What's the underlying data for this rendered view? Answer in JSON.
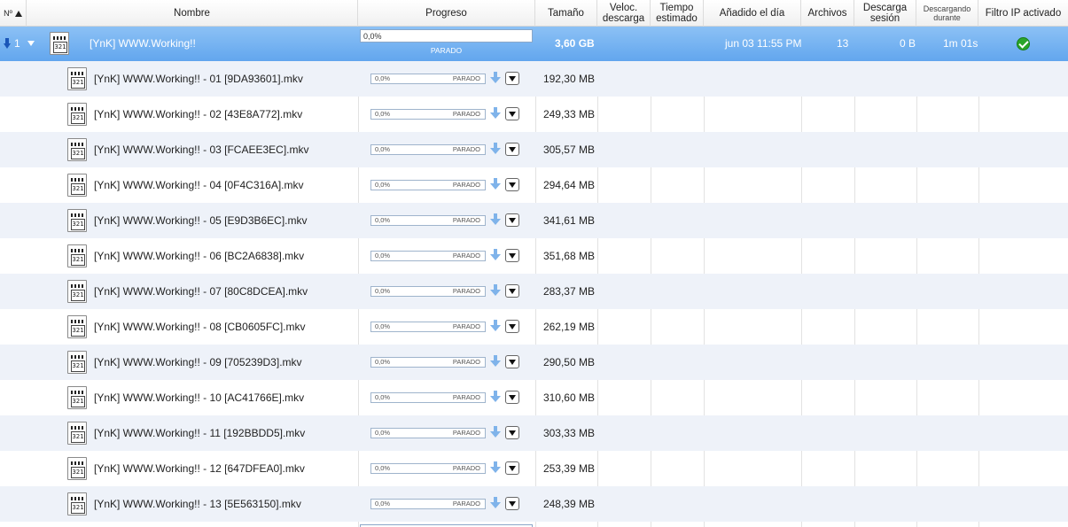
{
  "header": {
    "num": "Nº",
    "nombre": "Nombre",
    "progreso": "Progreso",
    "tamano": "Tamaño",
    "veloc": "Veloc. descarga",
    "tiempo": "Tiempo estimado",
    "anadido": "Añadido el día",
    "archivos": "Archivos",
    "descarga_sesion": "Descarga sesión",
    "descargando": "Descargando durante",
    "filtro": "Filtro IP activado"
  },
  "torrent": {
    "index": "1",
    "name": "[YnK] WWW.Working!!",
    "progress": "0,0%",
    "progress_value": 0,
    "state": "PARADO",
    "size": "3,60 GB",
    "added": "jun 03 11:55 PM",
    "files": "13",
    "session": "0 B",
    "duration": "1m 01s",
    "filter_icon": "check-icon"
  },
  "file_progress": "0,0%",
  "file_state": "PARADO",
  "files": [
    {
      "name": "[YnK] WWW.Working!! - 01 [9DA93601].mkv",
      "size": "192,30 MB"
    },
    {
      "name": "[YnK] WWW.Working!! - 02 [43E8A772].mkv",
      "size": "249,33 MB"
    },
    {
      "name": "[YnK] WWW.Working!! - 03 [FCAEE3EC].mkv",
      "size": "305,57 MB"
    },
    {
      "name": "[YnK] WWW.Working!! - 04 [0F4C316A].mkv",
      "size": "294,64 MB"
    },
    {
      "name": "[YnK] WWW.Working!! - 05 [E9D3B6EC].mkv",
      "size": "341,61 MB"
    },
    {
      "name": "[YnK] WWW.Working!! - 06 [BC2A6838].mkv",
      "size": "351,68 MB"
    },
    {
      "name": "[YnK] WWW.Working!! - 07 [80C8DCEA].mkv",
      "size": "283,37 MB"
    },
    {
      "name": "[YnK] WWW.Working!! - 08 [CB0605FC].mkv",
      "size": "262,19 MB"
    },
    {
      "name": "[YnK] WWW.Working!! - 09 [705239D3].mkv",
      "size": "290,50 MB"
    },
    {
      "name": "[YnK] WWW.Working!! - 10 [AC41766E].mkv",
      "size": "310,60 MB"
    },
    {
      "name": "[YnK] WWW.Working!! - 11 [192BBDD5].mkv",
      "size": "303,33 MB"
    },
    {
      "name": "[YnK] WWW.Working!! - 12 [647DFEA0].mkv",
      "size": "253,39 MB"
    },
    {
      "name": "[YnK] WWW.Working!! - 13 [5E563150].mkv",
      "size": "248,39 MB"
    }
  ],
  "colors": {
    "selected_row": "#62a6ee",
    "alt_row": "#eef2f9",
    "arrow_blue": "#4a90e2",
    "check_green": "#2aa52a"
  }
}
